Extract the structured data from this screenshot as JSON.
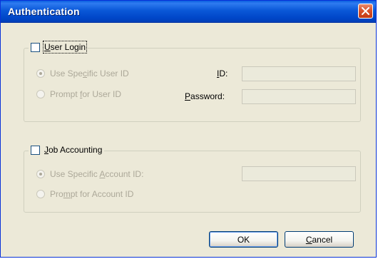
{
  "window": {
    "title": "Authentication",
    "close_icon": "close-x-icon"
  },
  "user_login": {
    "checkbox_label_pre": "",
    "checkbox_label_u": "U",
    "checkbox_label_post": "ser Login",
    "checked": false,
    "radio_specific": {
      "pre": "Use Spe",
      "u": "c",
      "post": "ific User ID",
      "selected": true
    },
    "radio_prompt": {
      "pre": "Prompt ",
      "u": "f",
      "post": "or User ID",
      "selected": false
    },
    "id_label": {
      "pre": "",
      "u": "I",
      "post": "D:"
    },
    "password_label": {
      "pre": "",
      "u": "P",
      "post": "assword:"
    },
    "id_value": "",
    "password_value": ""
  },
  "job_accounting": {
    "checkbox_label_pre": "",
    "checkbox_label_u": "J",
    "checkbox_label_post": "ob Accounting",
    "checked": false,
    "radio_specific": {
      "pre": "Use Specific ",
      "u": "A",
      "post": "ccount ID:",
      "selected": true
    },
    "radio_prompt": {
      "pre": "Pro",
      "u": "m",
      "post": "pt for Account ID",
      "selected": false
    },
    "account_id_value": ""
  },
  "buttons": {
    "ok": "OK",
    "cancel_pre": "",
    "cancel_u": "C",
    "cancel_post": "ancel"
  },
  "colors": {
    "title_bar": "#0a58d8",
    "face": "#ece9d8",
    "close": "#d9532c",
    "disabled_text": "#aca899"
  }
}
